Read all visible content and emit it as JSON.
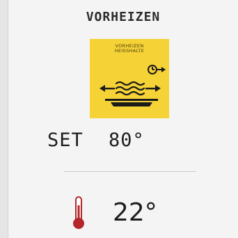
{
  "header": {
    "title": "VORHEIZEN"
  },
  "mode_tile": {
    "line1": "VORHEIZEN",
    "line2": "HEISSHALTE",
    "icon": "preheat-hold-icon",
    "color": "#f5d236"
  },
  "setpoint": {
    "label": "SET",
    "value": "80°"
  },
  "current": {
    "icon": "thermometer-icon",
    "value": "22°",
    "thermometer_color": "#b3262a"
  }
}
